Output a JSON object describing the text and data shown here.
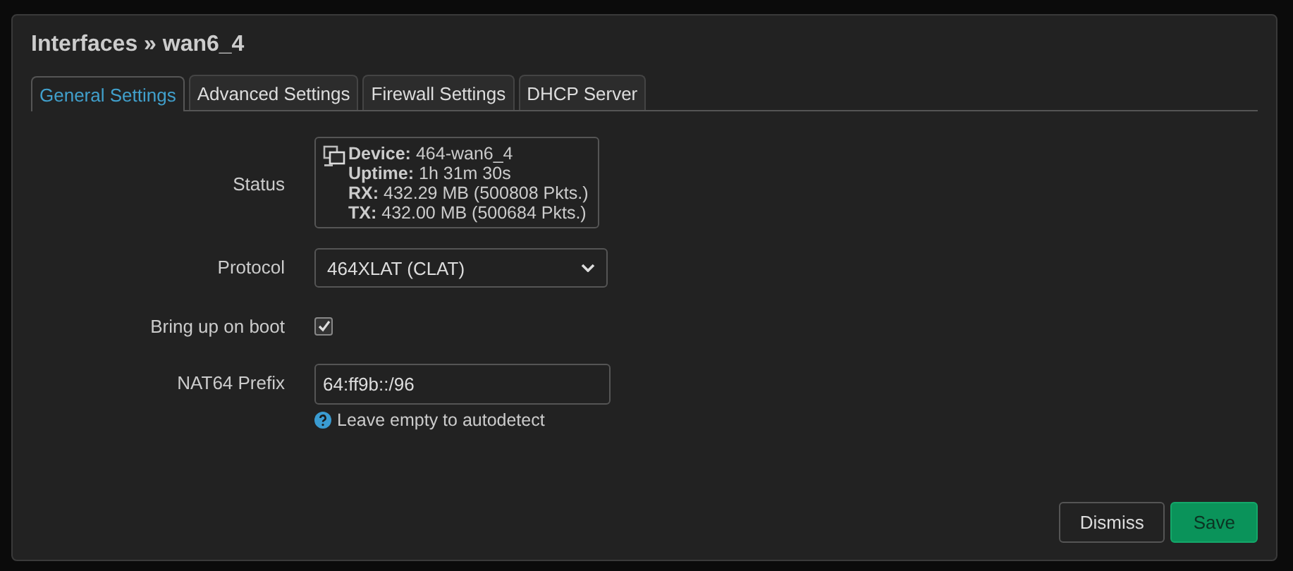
{
  "dialog": {
    "title": "Interfaces » wan6_4",
    "tabs": [
      {
        "label": "General Settings",
        "selected": true
      },
      {
        "label": "Advanced Settings",
        "selected": false
      },
      {
        "label": "Firewall Settings",
        "selected": false
      },
      {
        "label": "DHCP Server",
        "selected": false
      }
    ],
    "status": {
      "label": "Status",
      "lines": [
        {
          "key": "Device:",
          "value": "464-wan6_4"
        },
        {
          "key": "Uptime:",
          "value": "1h 31m 30s"
        },
        {
          "key": "RX:",
          "value": "432.29 MB (500808 Pkts.)"
        },
        {
          "key": "TX:",
          "value": "432.00 MB (500684 Pkts.)"
        }
      ]
    },
    "protocol": {
      "label": "Protocol",
      "value": "464XLAT (CLAT)"
    },
    "bring_up_on_boot": {
      "label": "Bring up on boot",
      "checked": true
    },
    "nat64_prefix": {
      "label": "NAT64 Prefix",
      "value": "64:ff9b::/96",
      "hint": "Leave empty to autodetect"
    },
    "buttons": [
      {
        "label": "Dismiss",
        "kind": "default"
      },
      {
        "label": "Save",
        "kind": "primary"
      }
    ]
  }
}
